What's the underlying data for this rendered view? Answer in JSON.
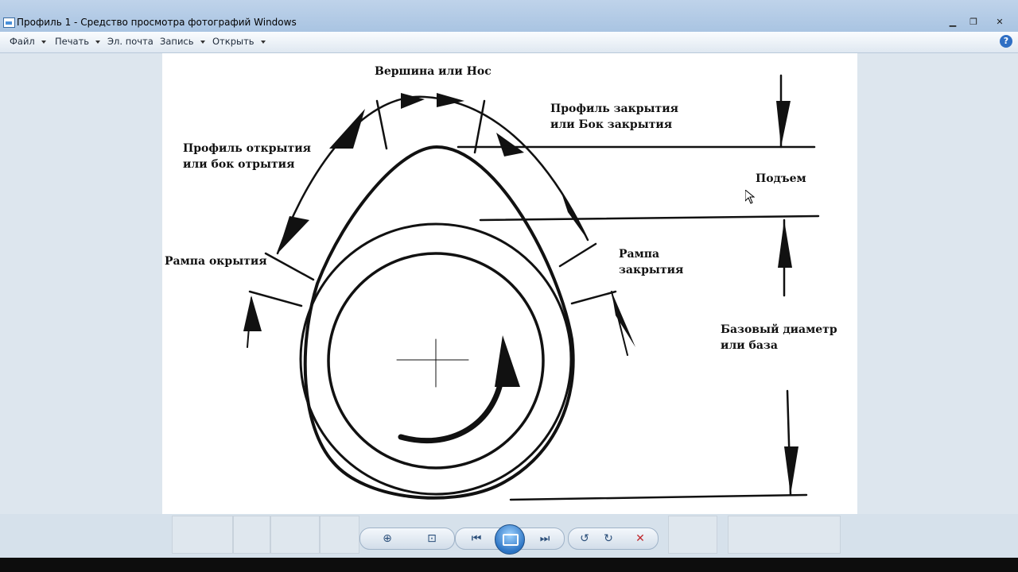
{
  "window": {
    "title": "Профиль 1 - Средство просмотра фотографий Windows",
    "minimize": "▁",
    "maximize": "❐",
    "close": "✕"
  },
  "menu": {
    "file": "Файл",
    "print": "Печать",
    "email": "Эл. почта",
    "burn": "Запись",
    "open": "Открыть",
    "help": "?"
  },
  "diagram": {
    "top_label": "Вершина или Нос",
    "closing_profile": [
      "Профиль закрытия",
      "или Бок закрытия"
    ],
    "opening_profile": [
      "Профиль  открытия",
      "или бок отрытия"
    ],
    "lift": "Подъем",
    "opening_ramp": "Рампа окрытия",
    "closing_ramp": [
      "Рампа",
      "закрытия"
    ],
    "base_circle": [
      "Базовый диаметр",
      "или база"
    ]
  },
  "controls": {
    "zoom": "⊕",
    "fit": "⊡",
    "prev": "⏮",
    "next": "⏭",
    "rotate_ccw": "↺",
    "rotate_cw": "↻",
    "delete": "✕"
  }
}
